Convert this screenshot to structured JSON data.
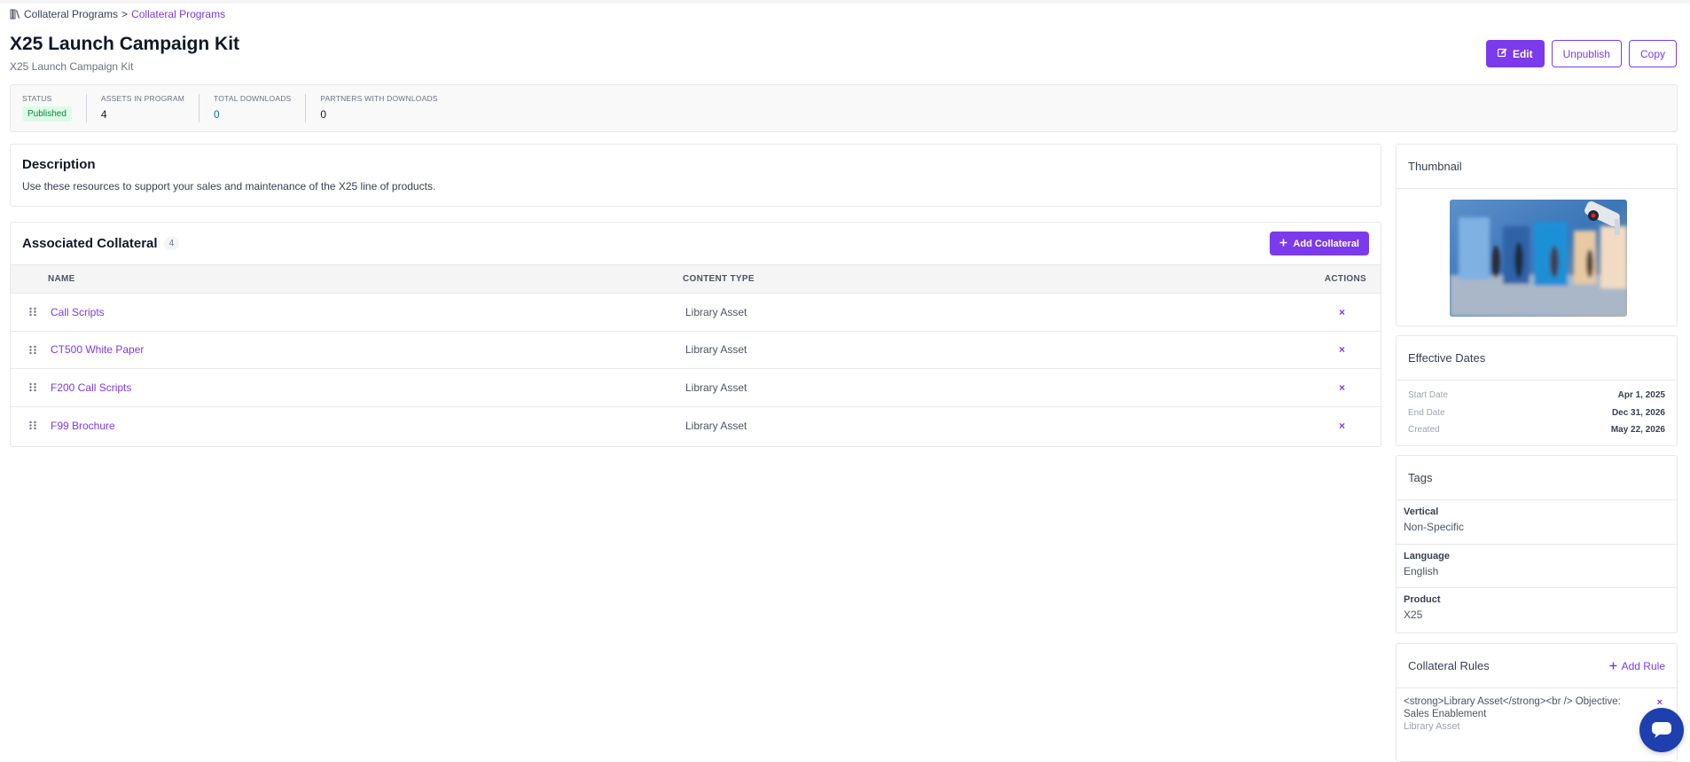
{
  "breadcrumb": {
    "root": "Collateral Programs",
    "separator": ">",
    "current": "Collateral Programs"
  },
  "page": {
    "title": "X25 Launch Campaign Kit",
    "subtitle": "X25 Launch Campaign Kit"
  },
  "header_buttons": {
    "edit": "Edit",
    "unpublish": "Unpublish",
    "copy": "Copy"
  },
  "stats": {
    "status_label": "STATUS",
    "status_value": "Published",
    "assets_label": "ASSETS IN PROGRAM",
    "assets_value": "4",
    "downloads_label": "TOTAL DOWNLOADS",
    "downloads_value": "0",
    "partners_label": "PARTNERS WITH DOWNLOADS",
    "partners_value": "0"
  },
  "description": {
    "heading": "Description",
    "text": "Use these resources to support your sales and maintenance of the X25 line of products."
  },
  "collateral": {
    "heading": "Associated Collateral",
    "count": "4",
    "add_label": "Add Collateral",
    "columns": {
      "name": "NAME",
      "type": "CONTENT TYPE",
      "actions": "ACTIONS"
    },
    "rows": [
      {
        "name": "Call Scripts",
        "type": "Library Asset",
        "remove": "×"
      },
      {
        "name": "CT500 White Paper",
        "type": "Library Asset",
        "remove": "×"
      },
      {
        "name": "F200 Call Scripts",
        "type": "Library Asset",
        "remove": "×"
      },
      {
        "name": "F99 Brochure",
        "type": "Library Asset",
        "remove": "×"
      }
    ]
  },
  "thumbnail": {
    "heading": "Thumbnail"
  },
  "dates": {
    "heading": "Effective Dates",
    "start_label": "Start Date",
    "start_value": "Apr 1, 2025",
    "end_label": "End Date",
    "end_value": "Dec 31, 2026",
    "created_label": "Created",
    "created_value": "May 22, 2026"
  },
  "tags": {
    "heading": "Tags",
    "items": [
      {
        "key": "Vertical",
        "value": "Non-Specific"
      },
      {
        "key": "Language",
        "value": "English"
      },
      {
        "key": "Product",
        "value": "X25"
      }
    ]
  },
  "rules": {
    "heading": "Collateral Rules",
    "add_label": "Add Rule",
    "items": [
      {
        "text": "<strong>Library Asset</strong><br /> Objective: Sales Enablement",
        "sub": "Library Asset",
        "remove": "×"
      }
    ]
  },
  "colors": {
    "accent": "#7c3aed",
    "published_bg": "#dcfce7",
    "published_fg": "#15803d",
    "chat": "#1e40af"
  },
  "icons": {
    "breadcrumb": "library-icon",
    "edit": "pencil-square-icon",
    "add": "plus-icon",
    "drag": "drag-handle-icon",
    "remove": "close-icon",
    "chat": "chat-bubble-icon"
  }
}
